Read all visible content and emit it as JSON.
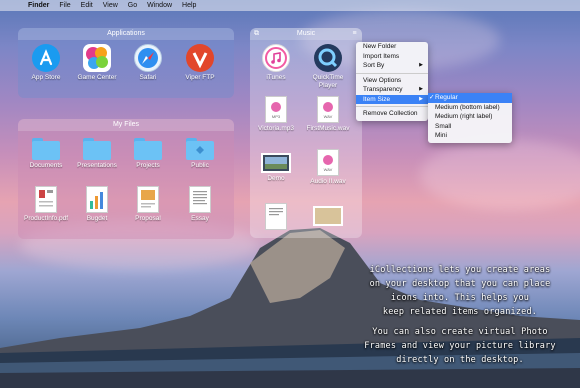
{
  "menubar": {
    "app": "Finder",
    "items": [
      "File",
      "Edit",
      "View",
      "Go",
      "Window",
      "Help"
    ]
  },
  "applications": {
    "title": "Applications",
    "items": [
      {
        "label": "App Store",
        "icon": "app-store-icon"
      },
      {
        "label": "Game Center",
        "icon": "game-center-icon"
      },
      {
        "label": "Safari",
        "icon": "safari-icon"
      },
      {
        "label": "Viper FTP",
        "icon": "viper-ftp-icon"
      }
    ]
  },
  "myfiles": {
    "title": "My Files",
    "items": [
      {
        "label": "Documents",
        "icon": "folder-icon"
      },
      {
        "label": "Presentations",
        "icon": "folder-icon"
      },
      {
        "label": "Projects",
        "icon": "folder-icon"
      },
      {
        "label": "Public",
        "icon": "folder-icon"
      },
      {
        "label": "ProductInfo.pdf",
        "icon": "pdf-document-icon"
      },
      {
        "label": "Bugdet",
        "icon": "spreadsheet-icon"
      },
      {
        "label": "Proposal",
        "icon": "document-icon"
      },
      {
        "label": "Essay",
        "icon": "document-icon"
      }
    ]
  },
  "music": {
    "title": "Music",
    "items": [
      {
        "label": "iTunes",
        "icon": "itunes-icon"
      },
      {
        "label": "QuickTime Player",
        "icon": "quicktime-icon"
      },
      {
        "label": "Victoria.mp3",
        "icon": "audio-file-icon"
      },
      {
        "label": "FirstMusic.wav",
        "icon": "audio-file-icon"
      },
      {
        "label": "Demo",
        "icon": "video-file-icon"
      },
      {
        "label": "Audio II.wav",
        "icon": "audio-file-icon"
      }
    ]
  },
  "context_menu": {
    "items": [
      "New Folder",
      "Import Items",
      "Sort By",
      "View Options",
      "Transparency",
      "Item Size",
      "Remove Collection"
    ],
    "submenu": [
      "Regular",
      "Medium (bottom label)",
      "Medium (right label)",
      "Small",
      "Mini"
    ],
    "submenu_selected": "Regular"
  },
  "caption": {
    "lines": [
      "iCollections lets you create areas",
      "on your desktop that you can place",
      "icons into. This helps you",
      "keep related items organized.",
      "",
      "You can also create virtual Photo",
      "Frames and view your picture library",
      "directly on the desktop."
    ]
  },
  "colors": {
    "accent": "#3b82f6",
    "folder": "#6cc2f5"
  }
}
